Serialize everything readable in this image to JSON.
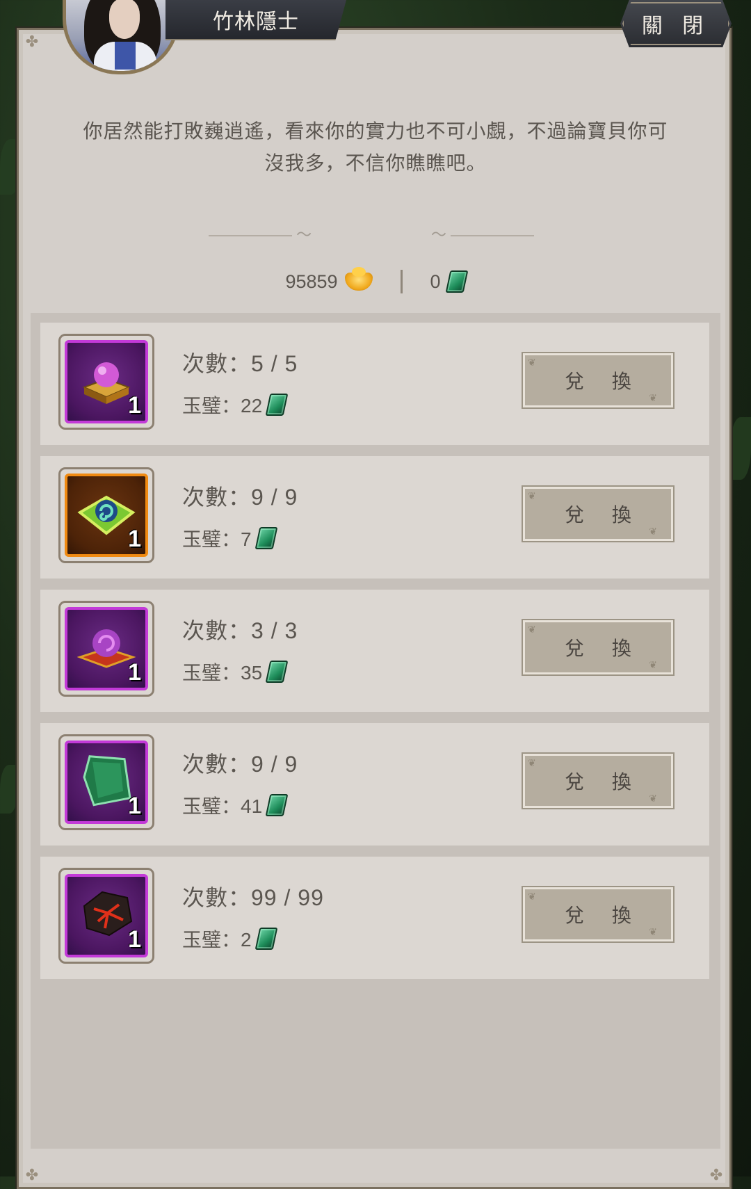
{
  "npc": {
    "name": "竹林隱士"
  },
  "close_label": "關 閉",
  "dialogue": {
    "line1": "你居然能打敗巍逍遙，看來你的實力也不可小覷，不過論寶貝你可",
    "line2": "沒我多，不信你瞧瞧吧。"
  },
  "currency": {
    "gold": "95859",
    "jade": "0"
  },
  "icons": {
    "gold": "gold-ingot-icon",
    "jade": "jade-token-icon"
  },
  "colors": {
    "purple_rarity": "#c33ad8",
    "orange_rarity": "#f08a12"
  },
  "items": [
    {
      "count": "次數：5 / 5",
      "price_label": "玉璧：22",
      "qty": "1",
      "button": "兌 換",
      "rarity": "purple",
      "icon": "purple-orb-altar-icon"
    },
    {
      "count": "次數：9 / 9",
      "price_label": "玉璧：7",
      "qty": "1",
      "button": "兌 換",
      "rarity": "orange",
      "icon": "green-spiral-orb-icon"
    },
    {
      "count": "次數：3 / 3",
      "price_label": "玉璧：35",
      "qty": "1",
      "button": "兌 換",
      "rarity": "purple",
      "icon": "purple-orb-red-stand-icon"
    },
    {
      "count": "次數：9 / 9",
      "price_label": "玉璧：41",
      "qty": "1",
      "button": "兌 換",
      "rarity": "purple",
      "icon": "green-jade-stone-icon"
    },
    {
      "count": "次數：99 / 99",
      "price_label": "玉璧：2",
      "qty": "1",
      "button": "兌 換",
      "rarity": "purple",
      "icon": "lava-rock-icon"
    }
  ]
}
